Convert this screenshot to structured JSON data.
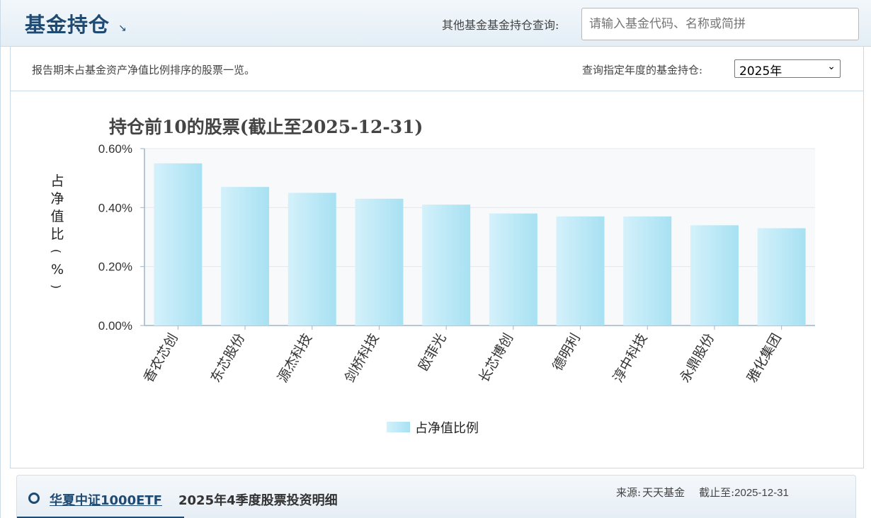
{
  "header": {
    "title": "基金持仓",
    "query_label": "其他基金基金持仓查询:",
    "search_placeholder": "请输入基金代码、名称或简拼"
  },
  "subbar": {
    "description": "报告期末占基金资产净值比例排序的股票一览。",
    "year_label": "查询指定年度的基金持仓:",
    "year_selected": "2025年"
  },
  "chart_data": {
    "type": "bar",
    "title": "持仓前10的股票(截止至2025-12-31)",
    "ylabel": "占净值比(%)",
    "xlabel": "",
    "categories": [
      "香农芯创",
      "东芯股份",
      "源杰科技",
      "剑桥科技",
      "欧菲光",
      "长芯博创",
      "德明利",
      "淳中科技",
      "永鼎股份",
      "雅化集团"
    ],
    "series": [
      {
        "name": "占净值比例",
        "values": [
          0.55,
          0.47,
          0.45,
          0.43,
          0.41,
          0.38,
          0.37,
          0.37,
          0.34,
          0.33
        ]
      }
    ],
    "ylim": [
      0,
      0.6
    ],
    "yticks": [
      0,
      0.2,
      0.4,
      0.6
    ],
    "ytick_labels": [
      "0.00%",
      "0.20%",
      "0.40%",
      "0.60%"
    ],
    "grid": true,
    "legend_position": "bottom"
  },
  "bottom": {
    "fund_name": "华夏中证1000ETF",
    "detail_title": "2025年4季度股票投资明细",
    "source_label": "来源:",
    "source_value": "天天基金",
    "cutoff_label": "截止至:",
    "cutoff_value": "2025-12-31"
  },
  "colors": {
    "bar_gradient_start": "#d4f1fb",
    "bar_gradient_end": "#a7e1f2",
    "brand": "#1f4a72"
  }
}
